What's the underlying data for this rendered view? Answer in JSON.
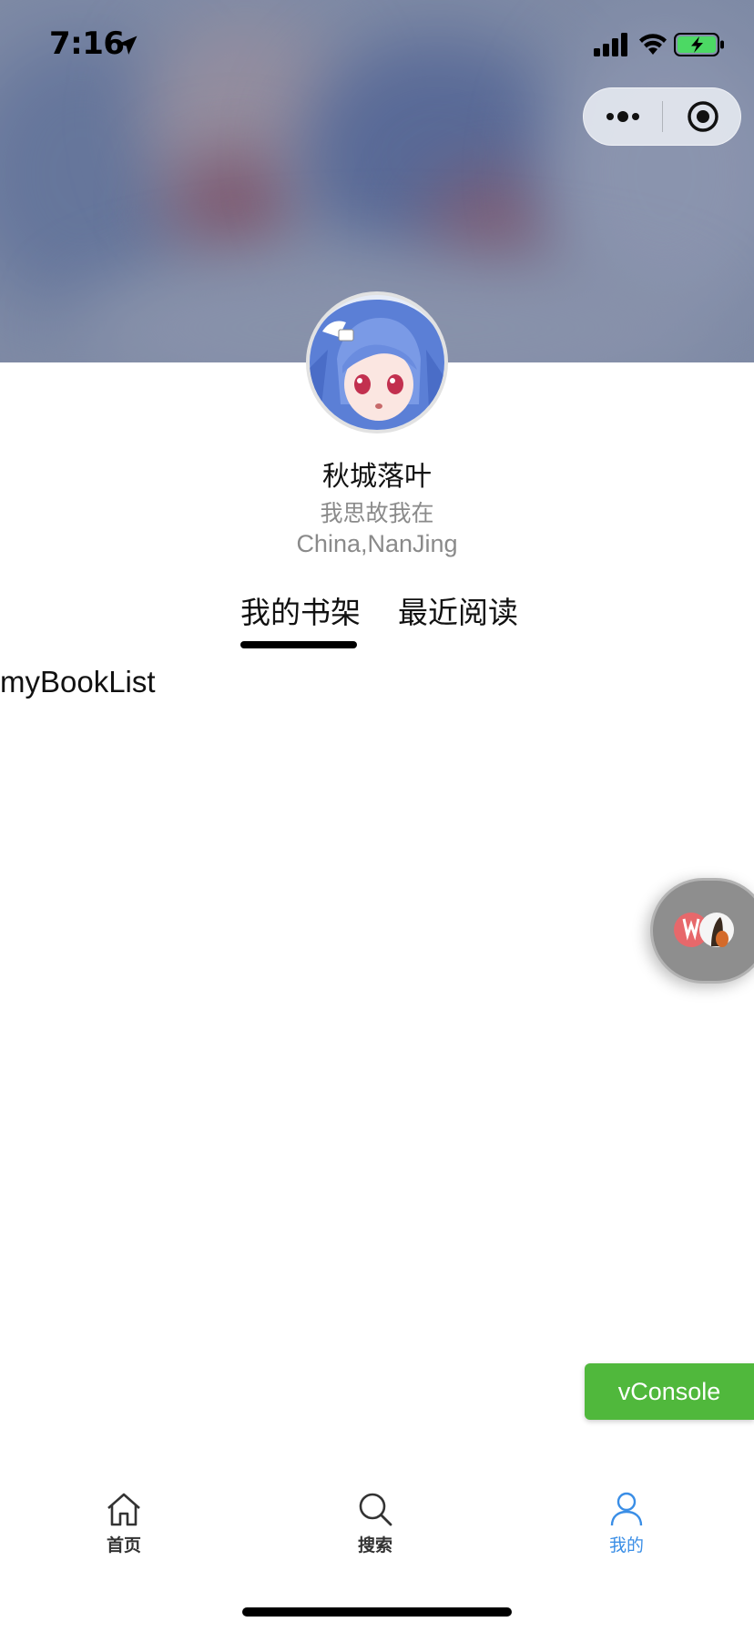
{
  "status_bar": {
    "time": "7:16"
  },
  "profile": {
    "name": "秋城落叶",
    "motto": "我思故我在",
    "location": "China,NanJing"
  },
  "tabs": [
    {
      "label": "我的书架",
      "active": true
    },
    {
      "label": "最近阅读",
      "active": false
    }
  ],
  "content": {
    "book_list_text": "myBookList"
  },
  "vconsole": {
    "label": "vConsole",
    "color": "#50b83c"
  },
  "tabbar": {
    "items": [
      {
        "label": "首页",
        "icon": "home-icon",
        "active": false
      },
      {
        "label": "搜索",
        "icon": "search-icon",
        "active": false
      },
      {
        "label": "我的",
        "icon": "user-icon",
        "active": true
      }
    ],
    "active_color": "#3a8ee6"
  }
}
